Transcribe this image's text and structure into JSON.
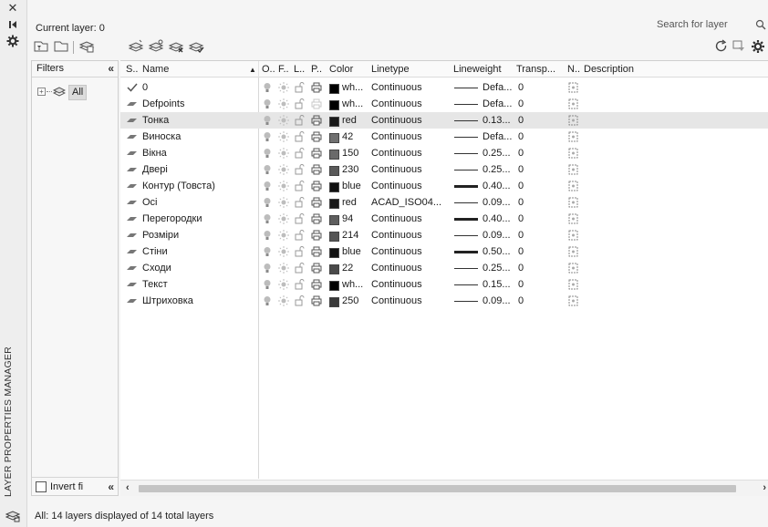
{
  "panel": {
    "vertical_title": "LAYER PROPERTIES MANAGER",
    "current_layer": "Current layer: 0",
    "search_placeholder": "Search for layer",
    "status_text": "All: 14 layers displayed of 14 total layers"
  },
  "filters": {
    "header": "Filters",
    "collapse_glyph": "«",
    "tree_expand": "⊞",
    "tree_root": "All",
    "invert_label": "Invert fi",
    "invert_checked": false
  },
  "columns": {
    "status": "S..",
    "name": "Name",
    "on": "O..",
    "freeze": "F..",
    "lock": "L..",
    "plot": "P..",
    "color": "Color",
    "linetype": "Linetype",
    "lineweight": "Lineweight",
    "transparency": "Transp...",
    "new_vp_freeze": "N..",
    "description": "Description"
  },
  "layers": [
    {
      "name": "0",
      "current": true,
      "color_name": "wh...",
      "color_hex": "#000000",
      "linetype": "Continuous",
      "lineweight": "Defa...",
      "lw_thick": false,
      "transparency": "0",
      "plot_off": false,
      "selected": false
    },
    {
      "name": "Defpoints",
      "current": false,
      "color_name": "wh...",
      "color_hex": "#000000",
      "linetype": "Continuous",
      "lineweight": "Defa...",
      "lw_thick": false,
      "transparency": "0",
      "plot_off": true,
      "selected": false
    },
    {
      "name": "Тонка",
      "current": false,
      "color_name": "red",
      "color_hex": "#1a1a1a",
      "linetype": "Continuous",
      "lineweight": "0.13...",
      "lw_thick": false,
      "transparency": "0",
      "plot_off": false,
      "selected": true
    },
    {
      "name": "Виноска",
      "current": false,
      "color_name": "42",
      "color_hex": "#707070",
      "linetype": "Continuous",
      "lineweight": "Defa...",
      "lw_thick": false,
      "transparency": "0",
      "plot_off": false,
      "selected": false
    },
    {
      "name": "Вікна",
      "current": false,
      "color_name": "150",
      "color_hex": "#6a6a6a",
      "linetype": "Continuous",
      "lineweight": "0.25...",
      "lw_thick": false,
      "transparency": "0",
      "plot_off": false,
      "selected": false
    },
    {
      "name": "Двері",
      "current": false,
      "color_name": "230",
      "color_hex": "#5a5a5a",
      "linetype": "Continuous",
      "lineweight": "0.25...",
      "lw_thick": false,
      "transparency": "0",
      "plot_off": false,
      "selected": false
    },
    {
      "name": "Контур (Товста)",
      "current": false,
      "color_name": "blue",
      "color_hex": "#111111",
      "linetype": "Continuous",
      "lineweight": "0.40...",
      "lw_thick": true,
      "transparency": "0",
      "plot_off": false,
      "selected": false
    },
    {
      "name": "Осі",
      "current": false,
      "color_name": "red",
      "color_hex": "#1a1a1a",
      "linetype": "ACAD_ISO04...",
      "lineweight": "0.09...",
      "lw_thick": false,
      "transparency": "0",
      "plot_off": false,
      "selected": false
    },
    {
      "name": "Перегородки",
      "current": false,
      "color_name": "94",
      "color_hex": "#5e5e5e",
      "linetype": "Continuous",
      "lineweight": "0.40...",
      "lw_thick": true,
      "transparency": "0",
      "plot_off": false,
      "selected": false
    },
    {
      "name": "Розміри",
      "current": false,
      "color_name": "214",
      "color_hex": "#555555",
      "linetype": "Continuous",
      "lineweight": "0.09...",
      "lw_thick": false,
      "transparency": "0",
      "plot_off": false,
      "selected": false
    },
    {
      "name": "Стіни",
      "current": false,
      "color_name": "blue",
      "color_hex": "#111111",
      "linetype": "Continuous",
      "lineweight": "0.50...",
      "lw_thick": true,
      "transparency": "0",
      "plot_off": false,
      "selected": false
    },
    {
      "name": "Сходи",
      "current": false,
      "color_name": "22",
      "color_hex": "#4a4a4a",
      "linetype": "Continuous",
      "lineweight": "0.25...",
      "lw_thick": false,
      "transparency": "0",
      "plot_off": false,
      "selected": false
    },
    {
      "name": "Текст",
      "current": false,
      "color_name": "wh...",
      "color_hex": "#000000",
      "linetype": "Continuous",
      "lineweight": "0.15...",
      "lw_thick": false,
      "transparency": "0",
      "plot_off": false,
      "selected": false
    },
    {
      "name": "Штриховка",
      "current": false,
      "color_name": "250",
      "color_hex": "#3a3a3a",
      "linetype": "Continuous",
      "lineweight": "0.09...",
      "lw_thick": false,
      "transparency": "0",
      "plot_off": false,
      "selected": false
    }
  ]
}
